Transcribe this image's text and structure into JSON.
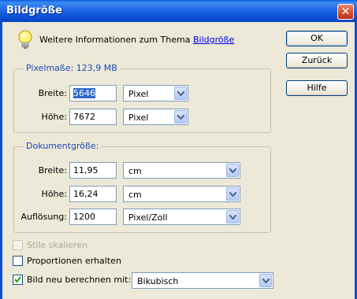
{
  "window": {
    "title": "Bildgröße",
    "close_glyph": "✕"
  },
  "info": {
    "text": "Weitere Informationen zum Thema ",
    "link": "Bildgröße",
    "icon": "lightbulb-icon"
  },
  "buttons": {
    "ok": "OK",
    "back": "Zurück",
    "help": "Hilfe"
  },
  "pixel_dimensions": {
    "title": "Pixelmaße: 123,9 MB",
    "width_label": "Breite:",
    "width_value": "5646",
    "width_unit": "Pixel",
    "height_label": "Höhe:",
    "height_value": "7672",
    "height_unit": "Pixel"
  },
  "document_size": {
    "title": "Dokumentgröße:",
    "width_label": "Breite:",
    "width_value": "11,95",
    "width_unit": "cm",
    "height_label": "Höhe:",
    "height_value": "16,24",
    "height_unit": "cm",
    "resolution_label": "Auflösung:",
    "resolution_value": "1200",
    "resolution_unit": "Pixel/Zoll"
  },
  "options": {
    "scale_styles": {
      "label": "Stile skalieren",
      "checked": false,
      "enabled": false
    },
    "constrain": {
      "label": "Proportionen erhalten",
      "checked": false,
      "enabled": true
    },
    "resample": {
      "label": "Bild neu berechnen mit:",
      "checked": true,
      "enabled": true
    },
    "resample_method": "Bikubisch"
  },
  "colors": {
    "titlebar": "#0a4fd4",
    "group_title": "#1f47b8",
    "link": "#0000ee",
    "selection": "#316ac5",
    "dialog_bg": "#ece9d8"
  }
}
